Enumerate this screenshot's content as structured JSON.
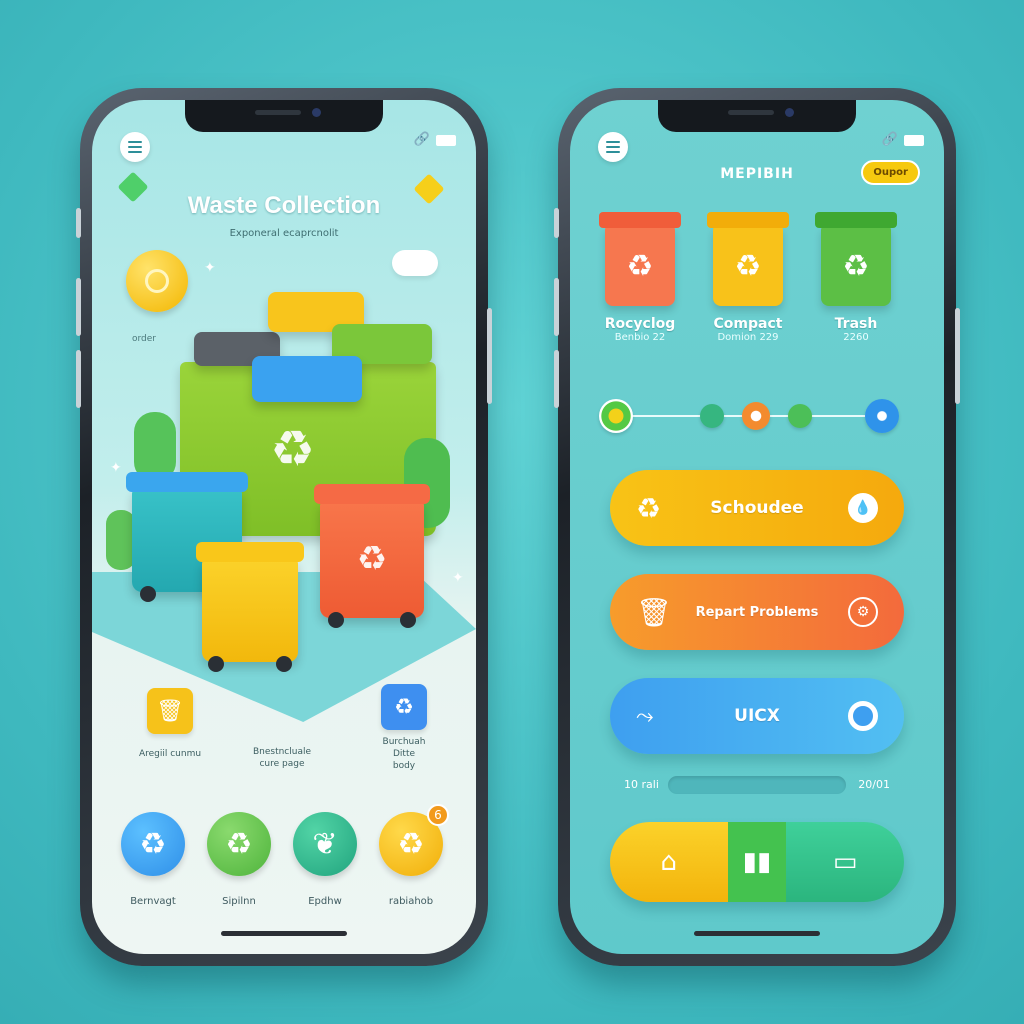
{
  "left_screen": {
    "title": "Waste Collection",
    "subtitle": "Exponeral ecaprcnolit",
    "coin_caption": "order",
    "features": [
      {
        "label": "Aregiil cunmu",
        "icon": "trash-bin-icon",
        "color": "#f6c21a"
      },
      {
        "label": "Bnestncluale\ncure page",
        "icon": "",
        "color": ""
      },
      {
        "label": "Burchuah\nDitte\nbody",
        "icon": "recycle-icon",
        "color": "#3e8ff0"
      }
    ],
    "categories": [
      {
        "label": "Bernvagt",
        "icon": "recycle-icon",
        "color": "#2f9cf0"
      },
      {
        "label": "Sipilnn",
        "icon": "recycle-icon",
        "color": "#5fbf4a"
      },
      {
        "label": "Epdhw",
        "icon": "leaf-icon",
        "color": "#2bb08c"
      },
      {
        "label": "rabiahob",
        "icon": "recycle-icon",
        "color": "#f6bd12",
        "badge": "6"
      }
    ]
  },
  "right_screen": {
    "title": "MEPIBIH",
    "open_label": "Oupor",
    "bins": [
      {
        "name": "Rocyclog",
        "date": "Benbio 22",
        "color": "#f6774f",
        "lid": "#f05d3a"
      },
      {
        "name": "Compact",
        "date": "Domion 229",
        "color": "#f8c21a",
        "lid": "#f2ad0a"
      },
      {
        "name": "Trash",
        "date": "2260",
        "color": "#5cbf45",
        "lid": "#3fa831"
      }
    ],
    "actions": [
      {
        "label": "Schoudee",
        "icon": "recycle-icon",
        "right_icon": "drop-icon",
        "gradient": "linear-gradient(90deg,#f8c316,#f5a90d)"
      },
      {
        "label": "Repart Problems",
        "icon": "bin-outline-icon",
        "right_icon": "wrench-icon",
        "gradient": "linear-gradient(90deg,#f79c2b,#f36a3c)"
      },
      {
        "label": "UICX",
        "icon": "fish-icon",
        "right_icon": "circle-icon",
        "gradient": "linear-gradient(90deg,#3e9ff0,#52bff2)"
      }
    ],
    "range": {
      "start": "10 rali",
      "end": "20/01"
    }
  }
}
